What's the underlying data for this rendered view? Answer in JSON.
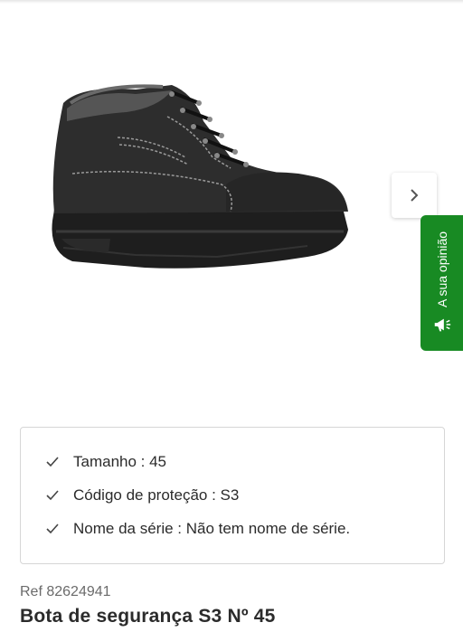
{
  "gallery": {
    "image_icon": "safety-boot-image",
    "next_icon": "chevron-right-icon"
  },
  "feedback": {
    "label": "A sua opinião",
    "icon": "megaphone-icon",
    "color": "#188a23"
  },
  "specs": {
    "icon": "check-icon",
    "rows": [
      "Tamanho : 45",
      "Código de proteção : S3",
      "Nome da série : Não tem nome de série."
    ]
  },
  "product": {
    "ref": "Ref 82624941",
    "title": "Bota de segurança S3 Nº 45"
  }
}
